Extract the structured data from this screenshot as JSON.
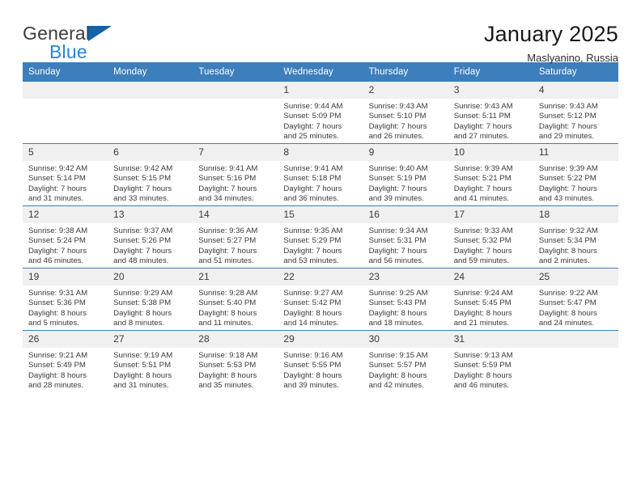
{
  "logo": {
    "word_one": "General",
    "word_two": "Blue",
    "triangle_color": "#1464a5",
    "blue_text_color": "#2a85d0"
  },
  "header": {
    "title": "January 2025",
    "subtitle": "Maslyanino, Russia",
    "accent_color": "#3d7ebc"
  },
  "calendar": {
    "weekday_headers": [
      "Sunday",
      "Monday",
      "Tuesday",
      "Wednesday",
      "Thursday",
      "Friday",
      "Saturday"
    ],
    "weeks": [
      [
        {
          "day": "",
          "lines": []
        },
        {
          "day": "",
          "lines": []
        },
        {
          "day": "",
          "lines": []
        },
        {
          "day": "1",
          "lines": [
            "Sunrise: 9:44 AM",
            "Sunset: 5:09 PM",
            "Daylight: 7 hours",
            "and 25 minutes."
          ]
        },
        {
          "day": "2",
          "lines": [
            "Sunrise: 9:43 AM",
            "Sunset: 5:10 PM",
            "Daylight: 7 hours",
            "and 26 minutes."
          ]
        },
        {
          "day": "3",
          "lines": [
            "Sunrise: 9:43 AM",
            "Sunset: 5:11 PM",
            "Daylight: 7 hours",
            "and 27 minutes."
          ]
        },
        {
          "day": "4",
          "lines": [
            "Sunrise: 9:43 AM",
            "Sunset: 5:12 PM",
            "Daylight: 7 hours",
            "and 29 minutes."
          ]
        }
      ],
      [
        {
          "day": "5",
          "lines": [
            "Sunrise: 9:42 AM",
            "Sunset: 5:14 PM",
            "Daylight: 7 hours",
            "and 31 minutes."
          ]
        },
        {
          "day": "6",
          "lines": [
            "Sunrise: 9:42 AM",
            "Sunset: 5:15 PM",
            "Daylight: 7 hours",
            "and 33 minutes."
          ]
        },
        {
          "day": "7",
          "lines": [
            "Sunrise: 9:41 AM",
            "Sunset: 5:16 PM",
            "Daylight: 7 hours",
            "and 34 minutes."
          ]
        },
        {
          "day": "8",
          "lines": [
            "Sunrise: 9:41 AM",
            "Sunset: 5:18 PM",
            "Daylight: 7 hours",
            "and 36 minutes."
          ]
        },
        {
          "day": "9",
          "lines": [
            "Sunrise: 9:40 AM",
            "Sunset: 5:19 PM",
            "Daylight: 7 hours",
            "and 39 minutes."
          ]
        },
        {
          "day": "10",
          "lines": [
            "Sunrise: 9:39 AM",
            "Sunset: 5:21 PM",
            "Daylight: 7 hours",
            "and 41 minutes."
          ]
        },
        {
          "day": "11",
          "lines": [
            "Sunrise: 9:39 AM",
            "Sunset: 5:22 PM",
            "Daylight: 7 hours",
            "and 43 minutes."
          ]
        }
      ],
      [
        {
          "day": "12",
          "lines": [
            "Sunrise: 9:38 AM",
            "Sunset: 5:24 PM",
            "Daylight: 7 hours",
            "and 46 minutes."
          ]
        },
        {
          "day": "13",
          "lines": [
            "Sunrise: 9:37 AM",
            "Sunset: 5:26 PM",
            "Daylight: 7 hours",
            "and 48 minutes."
          ]
        },
        {
          "day": "14",
          "lines": [
            "Sunrise: 9:36 AM",
            "Sunset: 5:27 PM",
            "Daylight: 7 hours",
            "and 51 minutes."
          ]
        },
        {
          "day": "15",
          "lines": [
            "Sunrise: 9:35 AM",
            "Sunset: 5:29 PM",
            "Daylight: 7 hours",
            "and 53 minutes."
          ]
        },
        {
          "day": "16",
          "lines": [
            "Sunrise: 9:34 AM",
            "Sunset: 5:31 PM",
            "Daylight: 7 hours",
            "and 56 minutes."
          ]
        },
        {
          "day": "17",
          "lines": [
            "Sunrise: 9:33 AM",
            "Sunset: 5:32 PM",
            "Daylight: 7 hours",
            "and 59 minutes."
          ]
        },
        {
          "day": "18",
          "lines": [
            "Sunrise: 9:32 AM",
            "Sunset: 5:34 PM",
            "Daylight: 8 hours",
            "and 2 minutes."
          ]
        }
      ],
      [
        {
          "day": "19",
          "lines": [
            "Sunrise: 9:31 AM",
            "Sunset: 5:36 PM",
            "Daylight: 8 hours",
            "and 5 minutes."
          ]
        },
        {
          "day": "20",
          "lines": [
            "Sunrise: 9:29 AM",
            "Sunset: 5:38 PM",
            "Daylight: 8 hours",
            "and 8 minutes."
          ]
        },
        {
          "day": "21",
          "lines": [
            "Sunrise: 9:28 AM",
            "Sunset: 5:40 PM",
            "Daylight: 8 hours",
            "and 11 minutes."
          ]
        },
        {
          "day": "22",
          "lines": [
            "Sunrise: 9:27 AM",
            "Sunset: 5:42 PM",
            "Daylight: 8 hours",
            "and 14 minutes."
          ]
        },
        {
          "day": "23",
          "lines": [
            "Sunrise: 9:25 AM",
            "Sunset: 5:43 PM",
            "Daylight: 8 hours",
            "and 18 minutes."
          ]
        },
        {
          "day": "24",
          "lines": [
            "Sunrise: 9:24 AM",
            "Sunset: 5:45 PM",
            "Daylight: 8 hours",
            "and 21 minutes."
          ]
        },
        {
          "day": "25",
          "lines": [
            "Sunrise: 9:22 AM",
            "Sunset: 5:47 PM",
            "Daylight: 8 hours",
            "and 24 minutes."
          ]
        }
      ],
      [
        {
          "day": "26",
          "lines": [
            "Sunrise: 9:21 AM",
            "Sunset: 5:49 PM",
            "Daylight: 8 hours",
            "and 28 minutes."
          ]
        },
        {
          "day": "27",
          "lines": [
            "Sunrise: 9:19 AM",
            "Sunset: 5:51 PM",
            "Daylight: 8 hours",
            "and 31 minutes."
          ]
        },
        {
          "day": "28",
          "lines": [
            "Sunrise: 9:18 AM",
            "Sunset: 5:53 PM",
            "Daylight: 8 hours",
            "and 35 minutes."
          ]
        },
        {
          "day": "29",
          "lines": [
            "Sunrise: 9:16 AM",
            "Sunset: 5:55 PM",
            "Daylight: 8 hours",
            "and 39 minutes."
          ]
        },
        {
          "day": "30",
          "lines": [
            "Sunrise: 9:15 AM",
            "Sunset: 5:57 PM",
            "Daylight: 8 hours",
            "and 42 minutes."
          ]
        },
        {
          "day": "31",
          "lines": [
            "Sunrise: 9:13 AM",
            "Sunset: 5:59 PM",
            "Daylight: 8 hours",
            "and 46 minutes."
          ]
        },
        {
          "day": "",
          "lines": []
        }
      ]
    ]
  }
}
